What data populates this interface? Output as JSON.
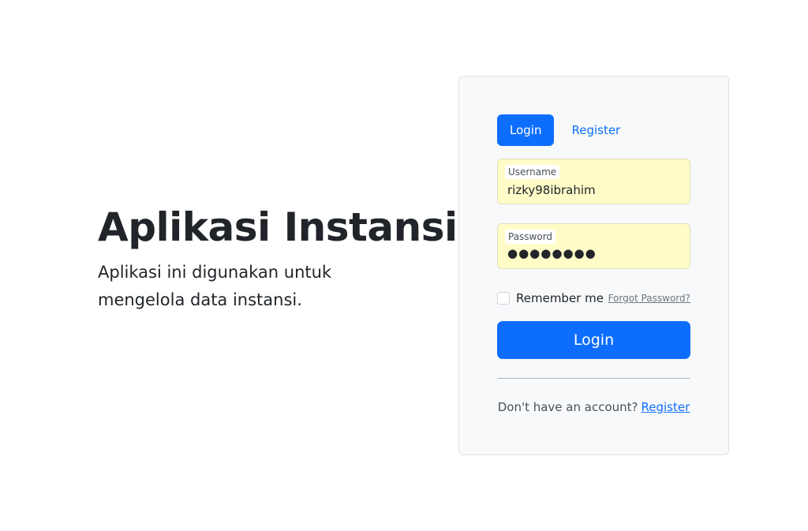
{
  "hero": {
    "title": "Aplikasi Instansi",
    "description": "Aplikasi ini digunakan untuk mengelola data instansi."
  },
  "tabs": [
    {
      "label": "Login",
      "active": true
    },
    {
      "label": "Register",
      "active": false
    }
  ],
  "form": {
    "username_label": "Username",
    "username_value": "rizky98ibrahim",
    "password_label": "Password",
    "password_value": "●●●●●●●●",
    "remember_label": "Remember me",
    "remember_checked": false,
    "forgot_label": "Forgot Password?",
    "submit_label": "Login"
  },
  "footer": {
    "prompt": "Don't have an account?",
    "register_link": "Register"
  },
  "colors": {
    "primary": "#0d6efd",
    "autofill": "#fffcc8",
    "card_bg": "#f8f9fa"
  }
}
